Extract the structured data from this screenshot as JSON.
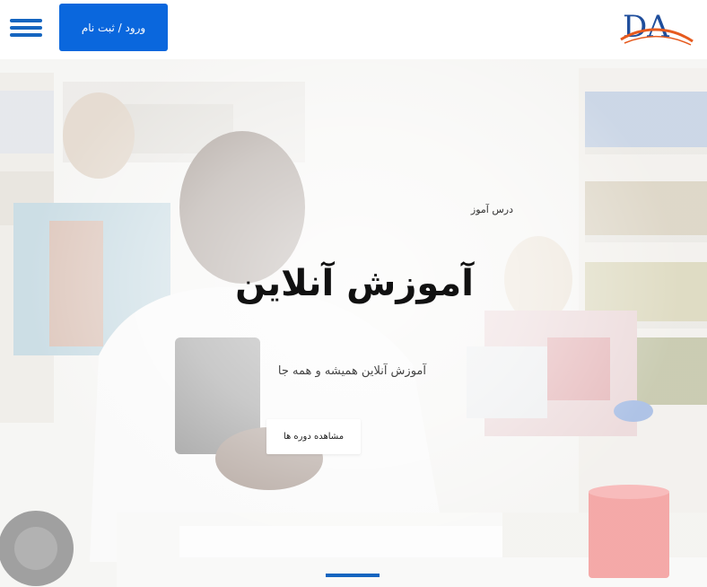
{
  "header": {
    "login_label": "ورود / ثبت نام",
    "logo_text": "DA"
  },
  "hero": {
    "kicker": "درس آموز",
    "title": "آموزش آنلاین",
    "subtitle": "آموزش آنلاین همیشه و همه جا",
    "cta_label": "مشاهده دوره ها"
  },
  "colors": {
    "primary_blue": "#0a67dd",
    "nav_blue": "#1565c0",
    "logo_blue": "#1f4e9c",
    "logo_orange": "#e65a1e",
    "mug_red": "#e8403f"
  }
}
